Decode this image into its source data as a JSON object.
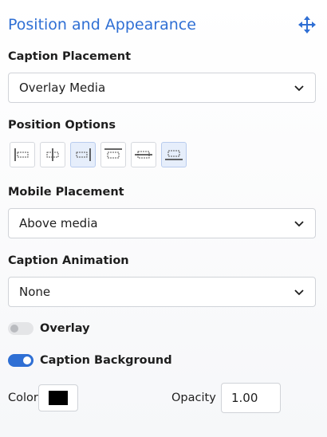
{
  "panel": {
    "title": "Position and Appearance",
    "move_icon": "move-arrows-icon",
    "accent_color": "#2f6fd4"
  },
  "caption_placement": {
    "label": "Caption Placement",
    "value": "Overlay Media"
  },
  "position_options": {
    "label": "Position Options",
    "buttons": [
      {
        "icon": "align-left-icon",
        "active": false
      },
      {
        "icon": "align-center-icon",
        "active": false
      },
      {
        "icon": "align-right-icon",
        "active": true
      },
      {
        "icon": "align-top-icon",
        "active": false
      },
      {
        "icon": "align-middle-icon",
        "active": false
      },
      {
        "icon": "align-bottom-icon",
        "active": true
      }
    ]
  },
  "mobile_placement": {
    "label": "Mobile Placement",
    "value": "Above media"
  },
  "caption_animation": {
    "label": "Caption Animation",
    "value": "None"
  },
  "overlay": {
    "label": "Overlay",
    "enabled": false
  },
  "caption_background": {
    "label": "Caption Background",
    "enabled": true
  },
  "color": {
    "label": "Color",
    "value": "#000000"
  },
  "opacity": {
    "label": "Opacity",
    "value": "1.00"
  }
}
